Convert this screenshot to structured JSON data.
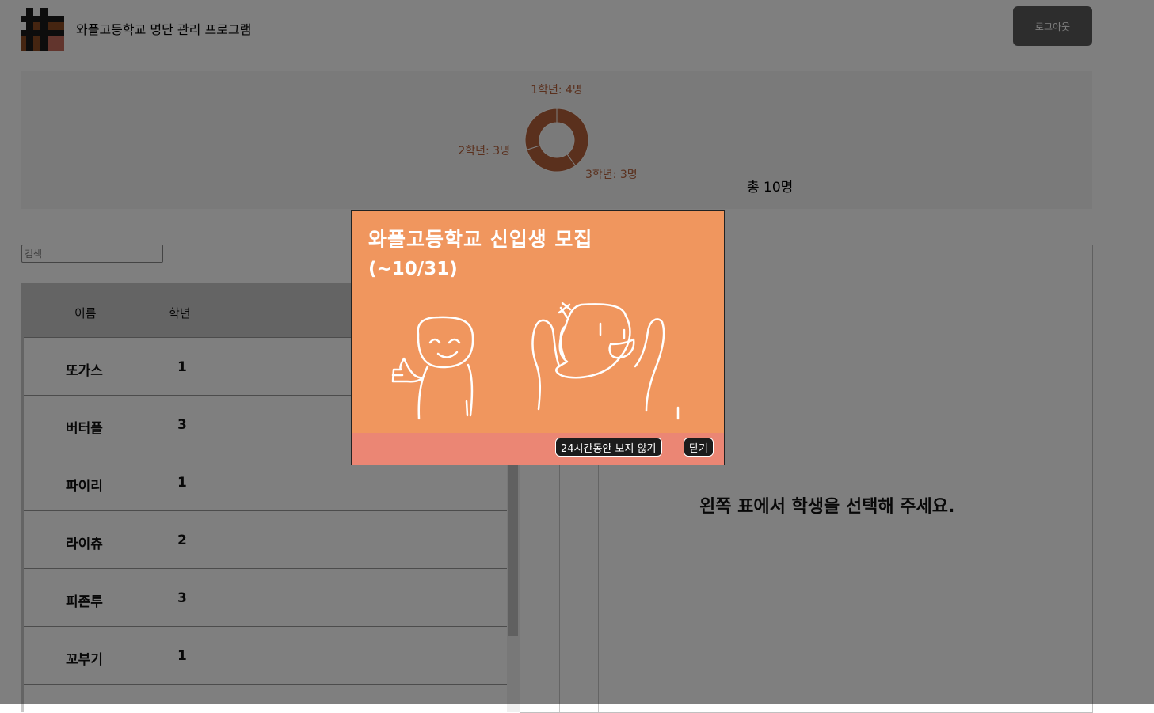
{
  "header": {
    "title": "와플고등학교 명단 관리 프로그램",
    "logout_label": "로그아웃"
  },
  "stats": {
    "total_label": "총 10명"
  },
  "chart_data": {
    "type": "pie",
    "categories": [
      "1학년",
      "2학년",
      "3학년"
    ],
    "values": [
      4,
      3,
      3
    ],
    "labels": [
      "1학년: 4명",
      "2학년: 3명",
      "3학년: 3명"
    ]
  },
  "search": {
    "placeholder": "검색"
  },
  "table": {
    "headers": {
      "name": "이름",
      "grade": "학년"
    },
    "rows": [
      {
        "name": "또가스",
        "grade": "1"
      },
      {
        "name": "버터플",
        "grade": "3"
      },
      {
        "name": "파이리",
        "grade": "1"
      },
      {
        "name": "라이츄",
        "grade": "2"
      },
      {
        "name": "피존투",
        "grade": "3"
      },
      {
        "name": "꼬부기",
        "grade": "1"
      }
    ]
  },
  "detail": {
    "empty_message": "왼쪽 표에서 학생을 선택해 주세요."
  },
  "popup": {
    "title": "와플고등학교 신입생 모집",
    "subtitle": "(~10/31)",
    "hide_24h_label": "24시간동안 보지 않기",
    "close_label": "닫기"
  },
  "colors": {
    "brand_brown": "#8b4a22",
    "chart_slice": "#b5603a",
    "popup_bg": "#f0965e",
    "popup_footer": "#eb8674"
  }
}
